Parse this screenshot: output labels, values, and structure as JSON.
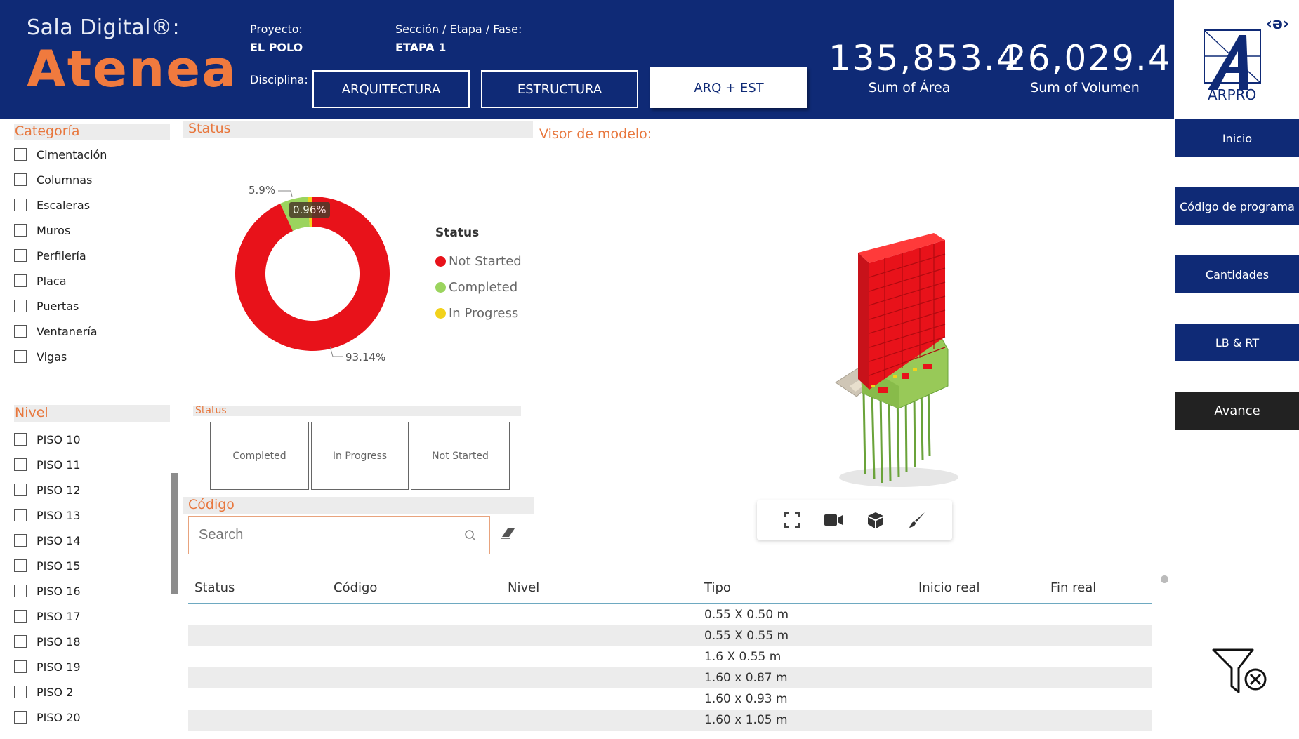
{
  "header": {
    "brand_sub": "Sala Digital®:",
    "brand_main": "Atenea",
    "proyecto_label": "Proyecto:",
    "proyecto_value": "EL POLO",
    "seccion_label": "Sección / Etapa / Fase:",
    "seccion_value": "ETAPA 1",
    "disciplina_label": "Disciplina:",
    "disciplinas": [
      "ARQUITECTURA",
      "ESTRUCTURA",
      "ARQ + EST"
    ],
    "kpi_area_value": "135,853.4",
    "kpi_area_label": "Sum of Área",
    "kpi_volumen_value": "26,029.4",
    "kpi_volumen_label": "Sum of Volumen",
    "brand_color": "#0f2a76",
    "accent_color": "#f07a3e"
  },
  "logo": {
    "code_glyph": "‹ə›",
    "text": "ARPRO"
  },
  "nav": {
    "items": [
      "Inicio",
      "Código de programa",
      "Cantidades",
      "LB & RT",
      "Avance"
    ]
  },
  "categoria": {
    "title": "Categoría",
    "items": [
      "Cimentación",
      "Columnas",
      "Escaleras",
      "Muros",
      "Perfilería",
      "Placa",
      "Puertas",
      "Ventanería",
      "Vigas"
    ]
  },
  "nivel": {
    "title": "Nivel",
    "items": [
      "PISO 10",
      "PISO 11",
      "PISO 12",
      "PISO 13",
      "PISO 14",
      "PISO 15",
      "PISO 16",
      "PISO 17",
      "PISO 18",
      "PISO 19",
      "PISO 2",
      "PISO 20"
    ]
  },
  "status_chart": {
    "section_title": "Status",
    "legend_title": "Status",
    "labels": {
      "not_started": "93.14%",
      "completed": "5.9%",
      "in_progress": "0.96%"
    }
  },
  "chart_data": {
    "type": "pie",
    "donut": true,
    "categories": [
      "Not Started",
      "Completed",
      "In Progress"
    ],
    "values": [
      93.14,
      5.9,
      0.96
    ],
    "colors": [
      "#e8121a",
      "#9bd45e",
      "#f2d21b"
    ],
    "title": "Status",
    "legend_placement": "right"
  },
  "status_filter": {
    "title": "Status",
    "buttons": [
      "Completed",
      "In Progress",
      "Not Started"
    ]
  },
  "codigo": {
    "title": "Código",
    "search_placeholder": "Search"
  },
  "viewer": {
    "title": "Visor de modelo:"
  },
  "table": {
    "columns": [
      "Status",
      "Código",
      "Nivel",
      "Tipo",
      "Inicio real",
      "Fin real"
    ],
    "rows": [
      {
        "tipo": "0.55 X 0.50 m"
      },
      {
        "tipo": "0.55 X 0.55 m"
      },
      {
        "tipo": "1.6 X 0.55 m"
      },
      {
        "tipo": "1.60 x 0.87 m"
      },
      {
        "tipo": "1.60 x 0.93 m"
      },
      {
        "tipo": "1.60 x 1.05 m"
      }
    ]
  }
}
